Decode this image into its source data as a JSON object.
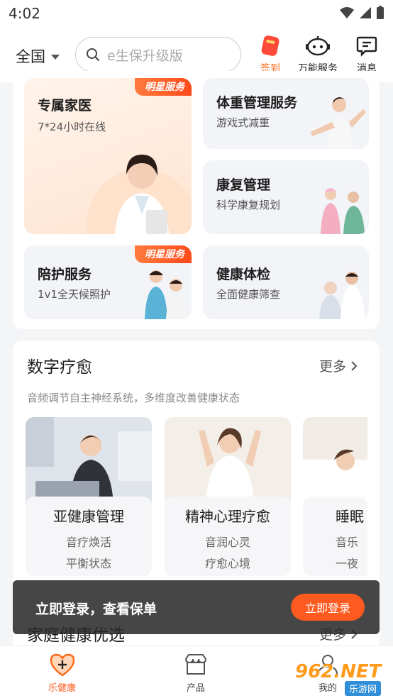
{
  "status_bar": {
    "time": "4:02"
  },
  "header": {
    "region": "全国",
    "search_placeholder": "e生保升级版",
    "actions": [
      {
        "label": "签到",
        "icon": "checkin-icon",
        "color": "#ff6a1a"
      },
      {
        "label": "万能服务",
        "icon": "robot-icon"
      },
      {
        "label": "消息",
        "icon": "message-icon"
      }
    ]
  },
  "services": {
    "family_doctor": {
      "title": "专属家医",
      "subtitle": "7*24小时在线",
      "badge": "明星服务"
    },
    "weight": {
      "title": "体重管理服务",
      "subtitle": "游戏式减重"
    },
    "rehab": {
      "title": "康复管理",
      "subtitle": "科学康复规划"
    },
    "escort": {
      "title": "陪护服务",
      "subtitle": "1v1全天候照护",
      "badge": "明星服务"
    },
    "checkup": {
      "title": "健康体检",
      "subtitle": "全面健康筛查"
    }
  },
  "digital_healing": {
    "title": "数字疗愈",
    "more": "更多",
    "description": "音频调节自主神经系统，多维度改善健康状态",
    "items": [
      {
        "title": "亚健康管理",
        "line1": "音疗焕活",
        "line2": "平衡状态"
      },
      {
        "title": "精神心理疗愈",
        "line1": "音润心灵",
        "line2": "疗愈心境"
      },
      {
        "title": "睡眠",
        "line1": "音乐",
        "line2": "一夜"
      }
    ]
  },
  "family_health": {
    "title": "家庭健康优选",
    "more": "更多"
  },
  "login_toast": {
    "text": "立即登录，查看保单",
    "button": "立即登录"
  },
  "tabbar": {
    "tabs": [
      {
        "label": "乐健康",
        "active": true
      },
      {
        "label": "产品",
        "active": false
      },
      {
        "label": "我的",
        "active": false
      }
    ]
  },
  "watermark": {
    "text": "962.NET",
    "sub": "乐游网"
  },
  "colors": {
    "accent": "#ff5a1f",
    "badge": "#ff4a1a"
  }
}
